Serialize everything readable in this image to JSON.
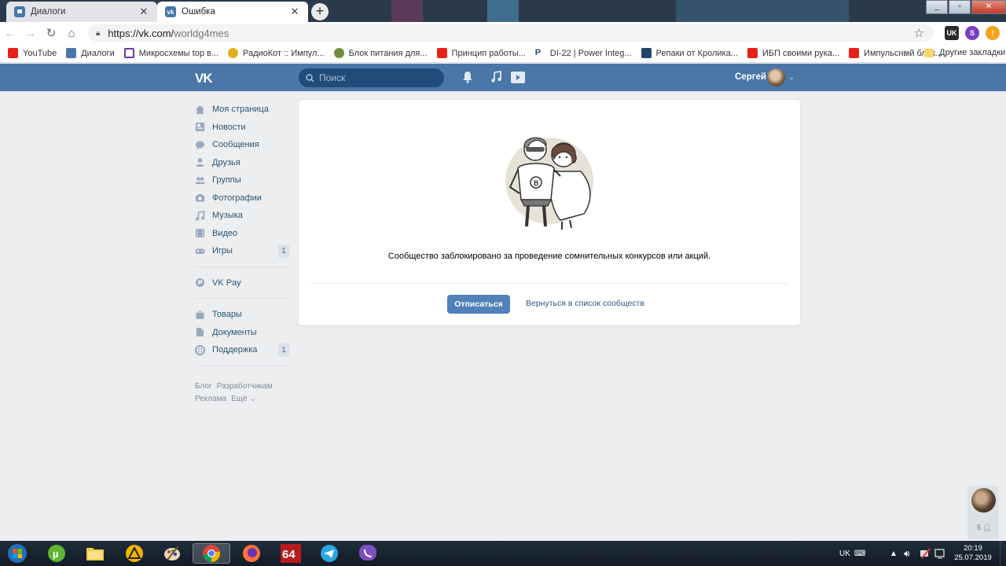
{
  "browser": {
    "tabs": [
      {
        "title": "Диалоги",
        "active": false
      },
      {
        "title": "Ошибка",
        "active": true
      }
    ],
    "url_host": "https://vk.com/",
    "url_path": "worldg4mes",
    "extensions": [
      {
        "label": "UK",
        "color": "#2b2b2b"
      },
      {
        "label": "S",
        "color": "#7a3fbf"
      },
      {
        "label": "!",
        "color": "#f4a31b"
      }
    ],
    "bookmarks": [
      {
        "label": "YouTube",
        "color": "#e62117"
      },
      {
        "label": "Диалоги",
        "color": "#4a76a8"
      },
      {
        "label": "Микросхемы top в...",
        "color": "#6b3a9a"
      },
      {
        "label": "РадиоКот :: Импул...",
        "color": "#e0b020"
      },
      {
        "label": "Блок питания для...",
        "color": "#6f8f3a"
      },
      {
        "label": "Принцип работы...",
        "color": "#e62117"
      },
      {
        "label": "DI-22 | Power Integ...",
        "color": "#2d4a7a"
      },
      {
        "label": "Репаки от Кролика...",
        "color": "#23456e"
      },
      {
        "label": "ИБП своими рука...",
        "color": "#e62117"
      },
      {
        "label": "Импульсный блок...",
        "color": "#e62117"
      }
    ],
    "bookmarks_more": "»",
    "other_bookmarks": "Другие закладки"
  },
  "vk": {
    "logo": "VK",
    "search_placeholder": "Поиск",
    "user_name": "Сергей",
    "menu": [
      {
        "label": "Моя страница",
        "icon": "home-icon"
      },
      {
        "label": "Новости",
        "icon": "news-icon"
      },
      {
        "label": "Сообщения",
        "icon": "messages-icon"
      },
      {
        "label": "Друзья",
        "icon": "friends-icon"
      },
      {
        "label": "Группы",
        "icon": "groups-icon"
      },
      {
        "label": "Фотографии",
        "icon": "camera-icon"
      },
      {
        "label": "Музыка",
        "icon": "music-icon"
      },
      {
        "label": "Видео",
        "icon": "video-icon"
      },
      {
        "label": "Игры",
        "icon": "gamepad-icon",
        "count": "1"
      }
    ],
    "menu2": [
      {
        "label": "VK Pay",
        "icon": "vkpay-icon"
      }
    ],
    "menu3": [
      {
        "label": "Товары",
        "icon": "bag-icon"
      },
      {
        "label": "Документы",
        "icon": "document-icon"
      },
      {
        "label": "Поддержка",
        "icon": "support-icon",
        "count": "1"
      }
    ],
    "footer": [
      "Блог",
      "Разработчикам",
      "Реклама",
      "Ещё ⌄"
    ],
    "error_message": "Сообщество заблокировано за проведение сомнительных конкурсов или акций.",
    "unsubscribe_label": "Отписаться",
    "back_link": "Вернуться в список сообществ",
    "chat_count": "5"
  },
  "taskbar": {
    "lang": "UK",
    "time": "20:19",
    "date": "25.07.2019"
  }
}
